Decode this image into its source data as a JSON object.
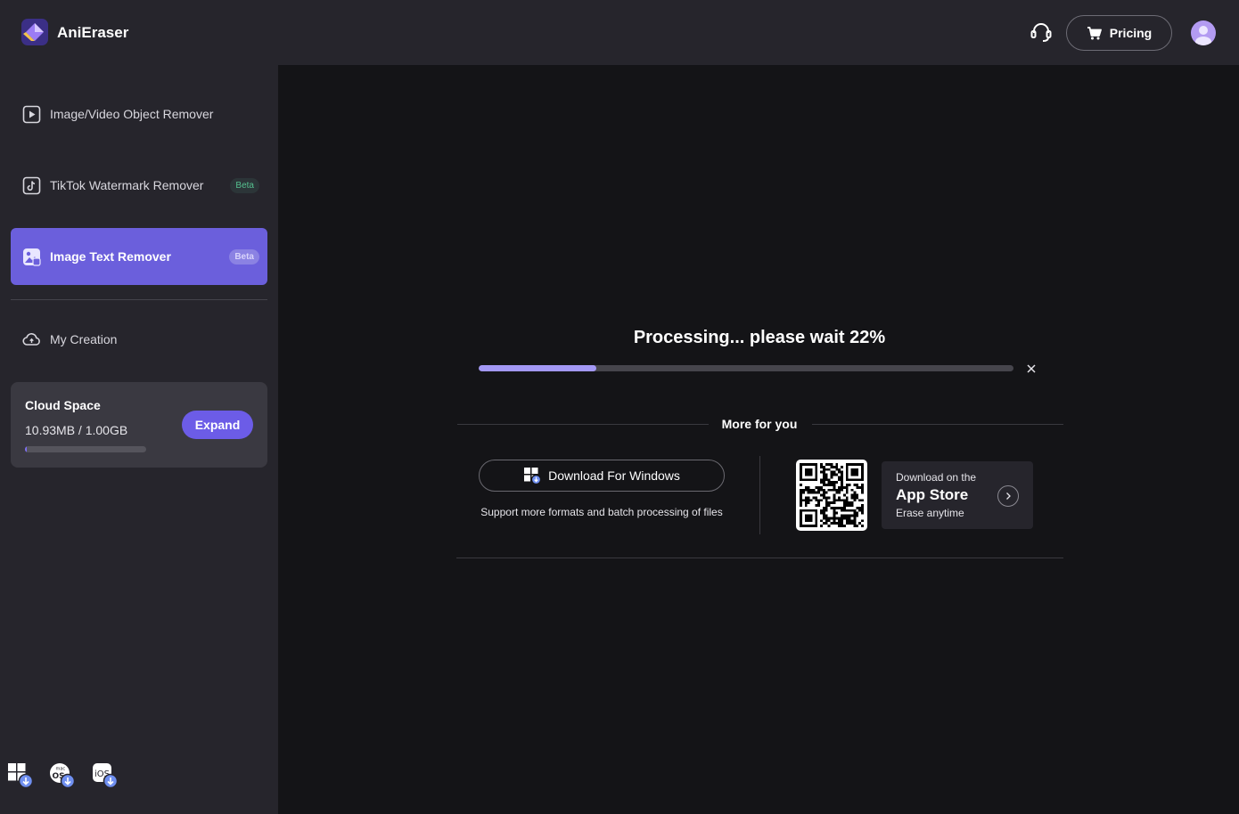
{
  "app": {
    "name": "AniEraser"
  },
  "header": {
    "pricing_label": "Pricing"
  },
  "sidebar": {
    "items": [
      {
        "label": "Image/Video Object Remover",
        "icon": "play-square-icon"
      },
      {
        "label": "TikTok Watermark Remover",
        "icon": "tiktok-icon",
        "badge": "Beta"
      },
      {
        "label": "Image Text Remover",
        "icon": "image-text-icon",
        "badge": "Beta",
        "active": true
      },
      {
        "label": "My Creation",
        "icon": "cloud-icon"
      }
    ],
    "cloud": {
      "title": "Cloud Space",
      "usage": "10.93MB / 1.00GB",
      "used_fraction": 0.011,
      "expand_label": "Expand"
    },
    "os_downloads": [
      "windows-download-icon",
      "macos-download-icon",
      "ios-download-icon"
    ]
  },
  "main": {
    "processing_text": "Processing... please wait 22%",
    "progress": 0.22,
    "more_for_you": "More for you",
    "download_windows": "Download For Windows",
    "download_sub": "Support more formats and batch processing of files",
    "appstore": {
      "small": "Download on the",
      "big": "App Store",
      "sub": "Erase anytime"
    }
  },
  "colors": {
    "accent": "#6c5ce7",
    "active_nav": "#6b5fdc",
    "progress_fill": "#a398f5",
    "sidebar_bg": "#26252c",
    "main_bg": "#141417"
  }
}
